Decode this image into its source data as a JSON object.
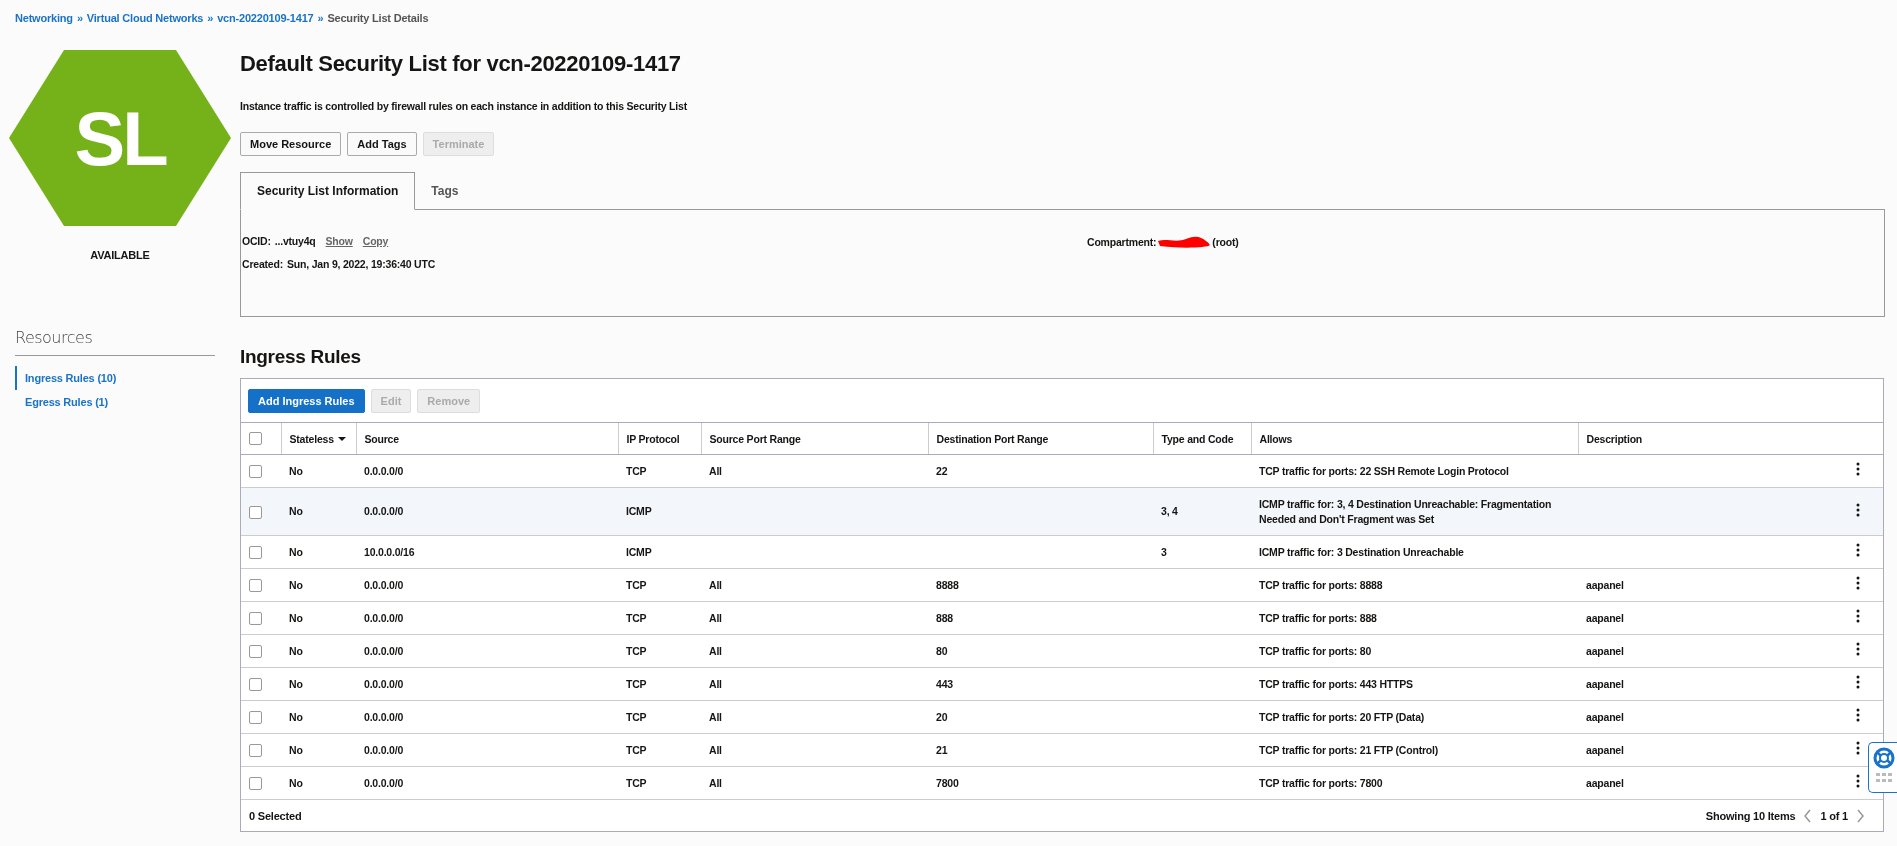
{
  "breadcrumb": [
    {
      "kind": "link",
      "label": "Networking"
    },
    {
      "kind": "separator",
      "label": "»"
    },
    {
      "kind": "link",
      "label": "Virtual Cloud Networks"
    },
    {
      "kind": "separator",
      "label": "»"
    },
    {
      "kind": "link",
      "label": "vcn-20220109-1417"
    },
    {
      "kind": "separator",
      "label": "»"
    },
    {
      "kind": "current",
      "label": "Security List Details"
    }
  ],
  "badge": {
    "initials": "SL",
    "status": "AVAILABLE"
  },
  "title": "Default Security List for vcn-20220109-1417",
  "description": "Instance traffic is controlled by firewall rules on each instance in addition to this Security List",
  "actions": [
    {
      "label": "Move Resource",
      "disabled": false
    },
    {
      "label": "Add Tags",
      "disabled": false
    },
    {
      "label": "Terminate",
      "disabled": true
    }
  ],
  "tabs": [
    {
      "label": "Security List Information",
      "selected": true
    },
    {
      "label": "Tags",
      "selected": false
    }
  ],
  "info": {
    "ocid_label": "OCID:",
    "ocid": "...vtuy4q",
    "links": [
      "Show",
      "Copy"
    ],
    "created_label": "Created:",
    "created": "Sun, Jan 9, 2022, 19:36:40 UTC",
    "compartment_label": "Compartment:",
    "compartment_redacted": true,
    "compartment_suffix": "(root)"
  },
  "sidebar": {
    "heading": "Resources",
    "items": [
      {
        "label": "Ingress Rules (10)",
        "selected": true
      },
      {
        "label": "Egress Rules (1)",
        "selected": false
      }
    ]
  },
  "section_title": "Ingress Rules",
  "toolbar": [
    {
      "label": "Add Ingress Rules",
      "kind": "primary",
      "disabled": false
    },
    {
      "label": "Edit",
      "kind": "default",
      "disabled": true
    },
    {
      "label": "Remove",
      "kind": "default",
      "disabled": true
    }
  ],
  "table": {
    "select_all_checked": false,
    "columns": [
      {
        "label": "Stateless",
        "sorted": true
      },
      {
        "label": "Source",
        "sorted": false
      },
      {
        "label": "IP Protocol",
        "sorted": false
      },
      {
        "label": "Source Port Range",
        "sorted": false
      },
      {
        "label": "Destination Port Range",
        "sorted": false
      },
      {
        "label": "Type and Code",
        "sorted": false
      },
      {
        "label": "Allows",
        "sorted": false
      },
      {
        "label": "Description",
        "sorted": false
      }
    ],
    "rows": [
      {
        "checked": false,
        "highlighted": false,
        "cells": [
          "No",
          "0.0.0.0/0",
          "TCP",
          "All",
          "22",
          "",
          "TCP traffic for ports: 22 SSH Remote Login Protocol",
          ""
        ]
      },
      {
        "checked": false,
        "highlighted": true,
        "cells": [
          "No",
          "0.0.0.0/0",
          "ICMP",
          "",
          "",
          "3, 4",
          "ICMP traffic for: 3, 4 Destination Unreachable: Fragmentation Needed and Don't Fragment was Set",
          ""
        ]
      },
      {
        "checked": false,
        "highlighted": false,
        "cells": [
          "No",
          "10.0.0.0/16",
          "ICMP",
          "",
          "",
          "3",
          "ICMP traffic for: 3 Destination Unreachable",
          ""
        ]
      },
      {
        "checked": false,
        "highlighted": false,
        "cells": [
          "No",
          "0.0.0.0/0",
          "TCP",
          "All",
          "8888",
          "",
          "TCP traffic for ports: 8888",
          "aapanel"
        ]
      },
      {
        "checked": false,
        "highlighted": false,
        "cells": [
          "No",
          "0.0.0.0/0",
          "TCP",
          "All",
          "888",
          "",
          "TCP traffic for ports: 888",
          "aapanel"
        ]
      },
      {
        "checked": false,
        "highlighted": false,
        "cells": [
          "No",
          "0.0.0.0/0",
          "TCP",
          "All",
          "80",
          "",
          "TCP traffic for ports: 80",
          "aapanel"
        ]
      },
      {
        "checked": false,
        "highlighted": false,
        "cells": [
          "No",
          "0.0.0.0/0",
          "TCP",
          "All",
          "443",
          "",
          "TCP traffic for ports: 443 HTTPS",
          "aapanel"
        ]
      },
      {
        "checked": false,
        "highlighted": false,
        "cells": [
          "No",
          "0.0.0.0/0",
          "TCP",
          "All",
          "20",
          "",
          "TCP traffic for ports: 20 FTP (Data)",
          "aapanel"
        ]
      },
      {
        "checked": false,
        "highlighted": false,
        "cells": [
          "No",
          "0.0.0.0/0",
          "TCP",
          "All",
          "21",
          "",
          "TCP traffic for ports: 21 FTP (Control)",
          "aapanel"
        ]
      },
      {
        "checked": false,
        "highlighted": false,
        "cells": [
          "No",
          "0.0.0.0/0",
          "TCP",
          "All",
          "7800",
          "",
          "TCP traffic for ports: 7800",
          "aapanel"
        ]
      }
    ]
  },
  "footer": {
    "selected": "0 Selected",
    "showing": "Showing 10 Items",
    "page": "1 of 1"
  }
}
